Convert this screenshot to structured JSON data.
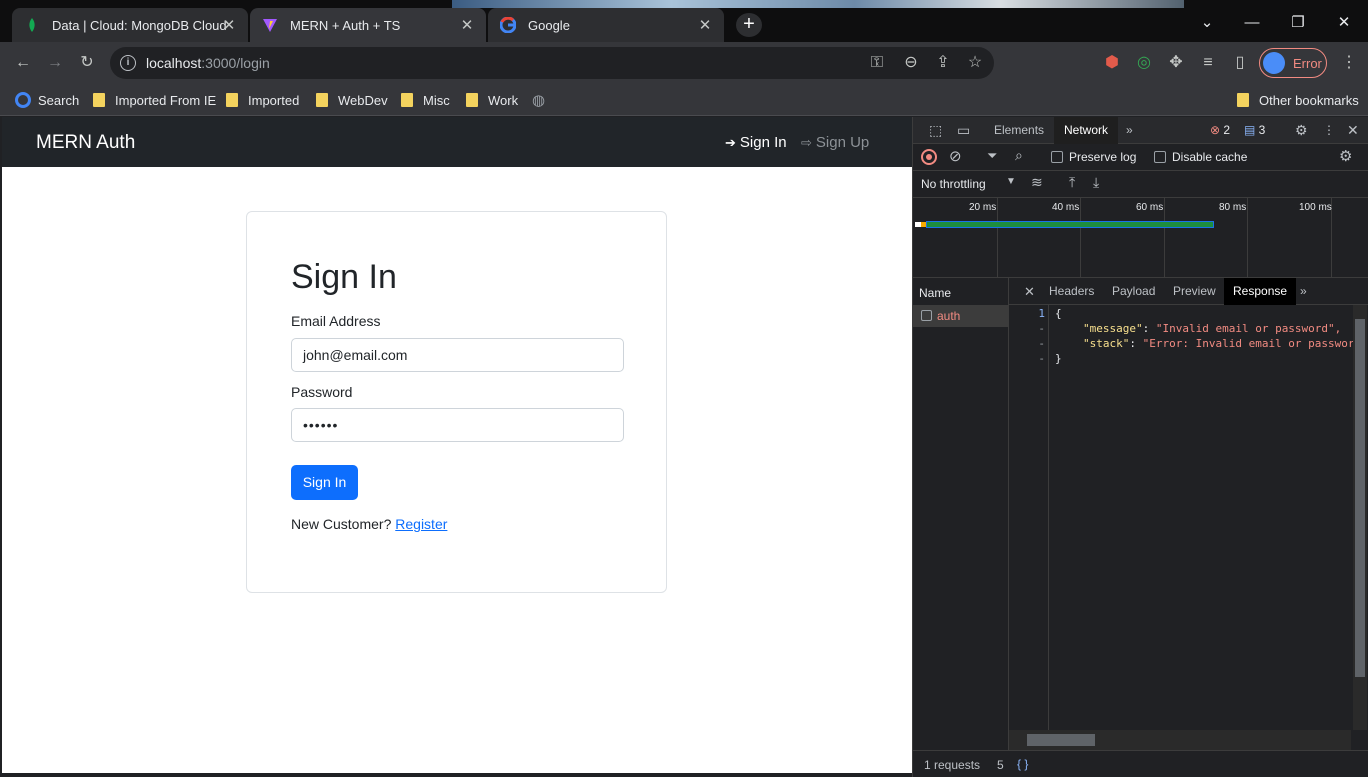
{
  "tabs": [
    {
      "title": "Data | Cloud: MongoDB Cloud",
      "icon": "mongodb-leaf-icon"
    },
    {
      "title": "MERN + Auth + TS",
      "icon": "vite-icon"
    },
    {
      "title": "Google",
      "icon": "google-icon"
    }
  ],
  "address": {
    "host": "localhost",
    "path": ":3000/login"
  },
  "profile": {
    "label": "Error"
  },
  "bookmarks": [
    {
      "label": "Search"
    },
    {
      "label": "Imported From IE"
    },
    {
      "label": "Imported"
    },
    {
      "label": "WebDev"
    },
    {
      "label": "Misc"
    },
    {
      "label": "Work"
    }
  ],
  "other_bookmarks": "Other bookmarks",
  "navbar": {
    "brand": "MERN Auth",
    "signin": "Sign In",
    "signup": "Sign Up"
  },
  "form": {
    "title": "Sign In",
    "email_label": "Email Address",
    "email_value": "john@email.com",
    "password_label": "Password",
    "password_value": "••••••",
    "submit": "Sign In",
    "new_customer": "New Customer?",
    "register": "Register"
  },
  "devtools": {
    "tabs": [
      "Elements",
      "Network"
    ],
    "errors": "2",
    "messages": "3",
    "preserve_log": "Preserve log",
    "disable_cache": "Disable cache",
    "throttling": "No throttling",
    "ticks": [
      "20 ms",
      "40 ms",
      "60 ms",
      "80 ms",
      "100 ms"
    ],
    "name_header": "Name",
    "request": "auth",
    "resp_tabs": [
      "Headers",
      "Payload",
      "Preview",
      "Response"
    ],
    "response_lines": [
      {
        "n": "1",
        "text": "{"
      },
      {
        "n": "-",
        "key": "\"message\"",
        "val": "\"Invalid email or password\","
      },
      {
        "n": "-",
        "key": "\"stack\"",
        "val": "\"Error: Invalid email or passwor"
      },
      {
        "n": "-",
        "text": "}"
      }
    ],
    "status": "1 requests",
    "status2": "5",
    "format": "{ }"
  }
}
